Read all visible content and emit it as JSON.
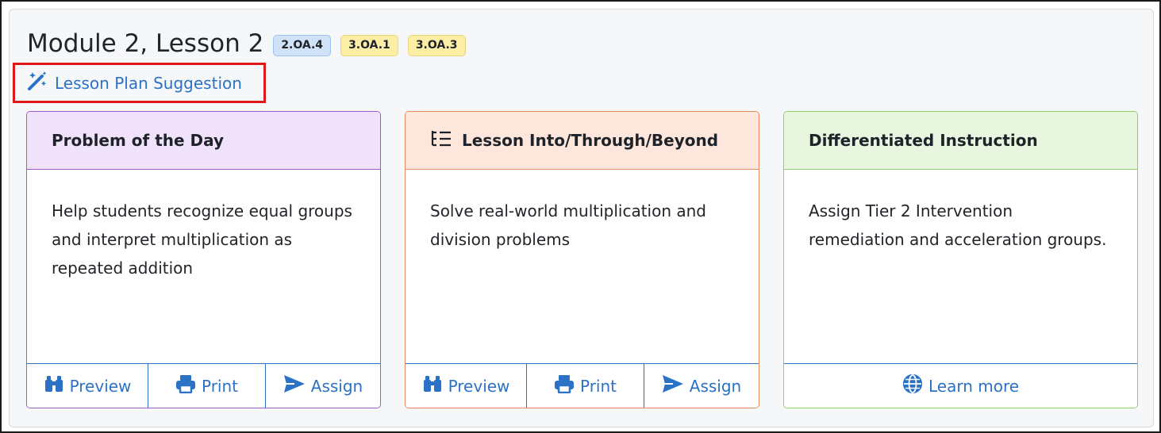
{
  "lesson": {
    "title": "Module 2, Lesson 2",
    "standards": [
      {
        "code": "2.OA.4",
        "color": "blue"
      },
      {
        "code": "3.OA.1",
        "color": "yellow"
      },
      {
        "code": "3.OA.3",
        "color": "yellow"
      }
    ],
    "suggestion_label": "Lesson Plan Suggestion",
    "suggestion_icon": "magic-wand-icon"
  },
  "cards": [
    {
      "title": "Problem of the Day",
      "description": "Help students recognize equal groups and interpret multiplication as repeated addition",
      "accent": "#9b59d0",
      "header_bg": "#f0e2fb",
      "actions": {
        "preview": "Preview",
        "print": "Print",
        "assign": "Assign"
      }
    },
    {
      "title": "Lesson Into/Through/Beyond",
      "icon": "list-tree-icon",
      "description": "Solve real-world multiplication and division problems",
      "accent": "#e88a5b",
      "header_bg": "#fde6db",
      "actions": {
        "preview": "Preview",
        "print": "Print",
        "assign": "Assign"
      }
    },
    {
      "title": "Differentiated Instruction",
      "description": "Assign Tier 2 Intervention remediation and acceleration groups.",
      "accent": "#8fcf6a",
      "header_bg": "#e8f5df",
      "actions": {
        "learn_more": "Learn more"
      }
    }
  ],
  "colors": {
    "link": "#2b72c6",
    "highlight_box": "#d9191c"
  }
}
